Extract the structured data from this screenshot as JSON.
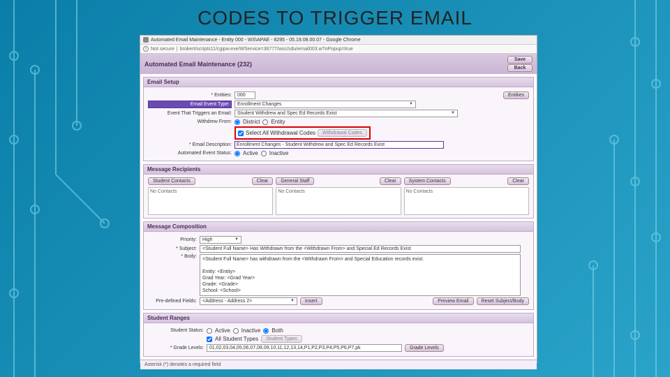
{
  "slide": {
    "title": "CODES TO TRIGGER EMAIL"
  },
  "chrome": {
    "tab_title": "Automated Email Maintenance - Entity 000 - WS\\APAE - 8295 - 05.19.08.00.07 - Google Chrome",
    "not_secure": "Not secure",
    "url": "brokert/scripts11/cgipw.exe/WService=36777/wsc/sdu/email003.w?oPopup=true"
  },
  "header": {
    "title": "Automated Email Maintenance (232)",
    "save": "Save",
    "back": "Back"
  },
  "email_setup": {
    "section": "Email Setup",
    "entities_lbl": "* Entities:",
    "entities_val": "000",
    "entities_btn": "Entities",
    "event_type_lbl": "Email Event Type:",
    "event_type_val": "Enrollment Changes",
    "trigger_lbl": "Event That Triggers an Email:",
    "trigger_val": "Student Withdrew and Spec Ed Records Exist",
    "withdrew_from_lbl": "Withdrew From:",
    "withdrew_district": "District",
    "withdrew_entity": "Entity",
    "select_all_codes": "Select All Withdrawal Codes",
    "withdraw_codes_btn": "Withdrawal Codes",
    "desc_lbl": "* Email Description:",
    "desc_val": "Enrollment Changes - Student Withdrew and Spec Ed Records Exist",
    "status_lbl": "Automated Event Status:",
    "active": "Active",
    "inactive": "Inactive"
  },
  "recipients": {
    "section": "Message Recipients",
    "student_contacts": "Student Contacts",
    "general_staff": "General Staff",
    "system_contacts": "System Contacts",
    "clear": "Clear",
    "no_contacts": "No Contacts"
  },
  "composition": {
    "section": "Message Composition",
    "priority_lbl": "Priority:",
    "priority_val": "High",
    "subject_lbl": "* Subject:",
    "subject_val": "<Student Full Name> Has Withdrawn from the <Withdrawn From> and Special Ed Records Exist",
    "body_lbl": "* Body:",
    "body_val": "<Student Full Name> has withdrawn from the <Withdrawn From> and Special Education records exist.\n\nEntity: <Entity>\nGrad Year: <Grad Year>\nGrade: <Grade>\nSchool: <School>\nWithdrawal Code: <Withdrawal Code>\nWithdrawal Date: <Withdrawal Date>",
    "predefined_lbl": "Pre-defined Fields:",
    "predefined_val": "<Address - Address 2>",
    "insert": "Insert",
    "preview": "Preview Email",
    "reset": "Reset Subject/Body"
  },
  "student_ranges": {
    "section": "Student Ranges",
    "status_lbl": "Student Status:",
    "active": "Active",
    "inactive": "Inactive",
    "both": "Both",
    "all_types": "All Student Types",
    "student_types_btn": "Student Types",
    "grade_lbl": "* Grade Levels:",
    "grade_val": "01,02,03,04,05,06,07,08,09,10,11,12,13,14,P1,P2,P3,P4,P5,P6,P7,pk",
    "grade_levels_btn": "Grade Levels"
  },
  "footer": {
    "note": "Asterisk (*) denotes a required field"
  }
}
